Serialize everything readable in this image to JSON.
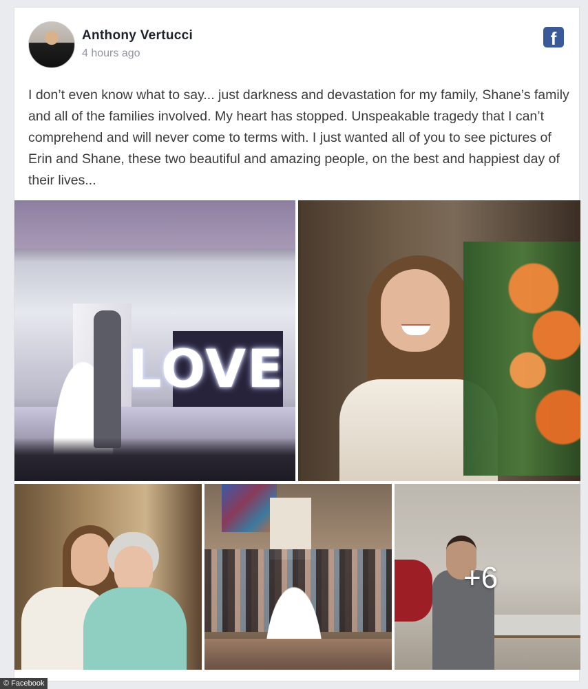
{
  "post": {
    "author": "Anthony Vertucci",
    "time": "4 hours ago",
    "text": "I don’t even know what to say... just darkness and devastation for my family, Shane’s family and all of the families involved. My heart has stopped. Unspeakable tragedy that I can’t comprehend and will never come to terms with. I just wanted all of you to see pictures of Erin and Shane, these two beautiful and amazing people, on the best and happiest day of their lives...",
    "brand_icon": "facebook-icon"
  },
  "photos": {
    "first_sign_text": "LOVE",
    "more_count": "+6"
  },
  "credit": "© Facebook",
  "colors": {
    "brand": "#3b5998",
    "text": "#3a3a3a",
    "meta": "#90949c",
    "background": "#e9ebee"
  }
}
